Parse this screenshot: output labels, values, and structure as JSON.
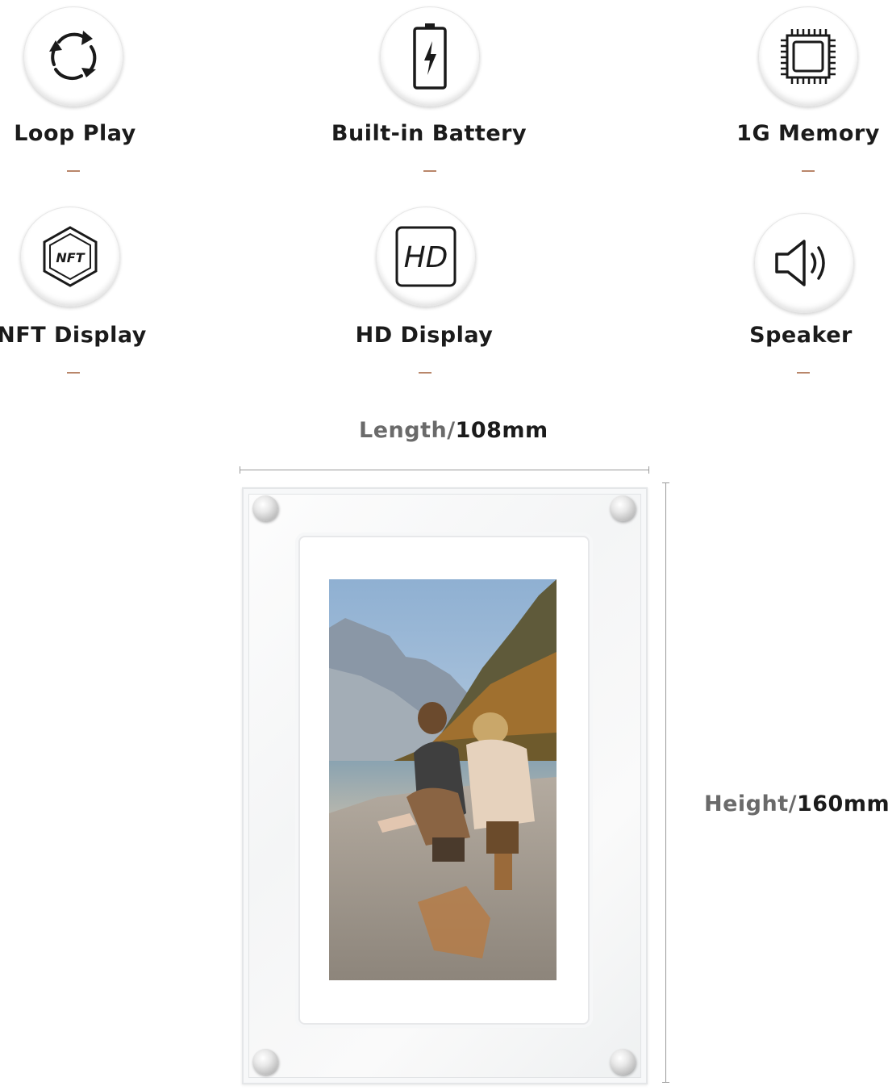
{
  "features": [
    {
      "label": "Loop Play",
      "icon": "loop-icon"
    },
    {
      "label": "Built-in Battery",
      "icon": "battery-icon"
    },
    {
      "label": "1G Memory",
      "icon": "memory-chip-icon"
    },
    {
      "label": "NFT Display",
      "icon": "nft-icon",
      "icon_text": "NFT"
    },
    {
      "label": "HD Display",
      "icon": "hd-icon",
      "icon_text": "HD"
    },
    {
      "label": "Speaker",
      "icon": "speaker-icon"
    }
  ],
  "dimensions": {
    "length": {
      "name": "Length/",
      "value": "108mm"
    },
    "height": {
      "name": "Height/",
      "value": "160mm"
    }
  },
  "colors": {
    "accent": "#b9866a",
    "text": "#1b1b1b",
    "muted": "#6a6a6a"
  }
}
